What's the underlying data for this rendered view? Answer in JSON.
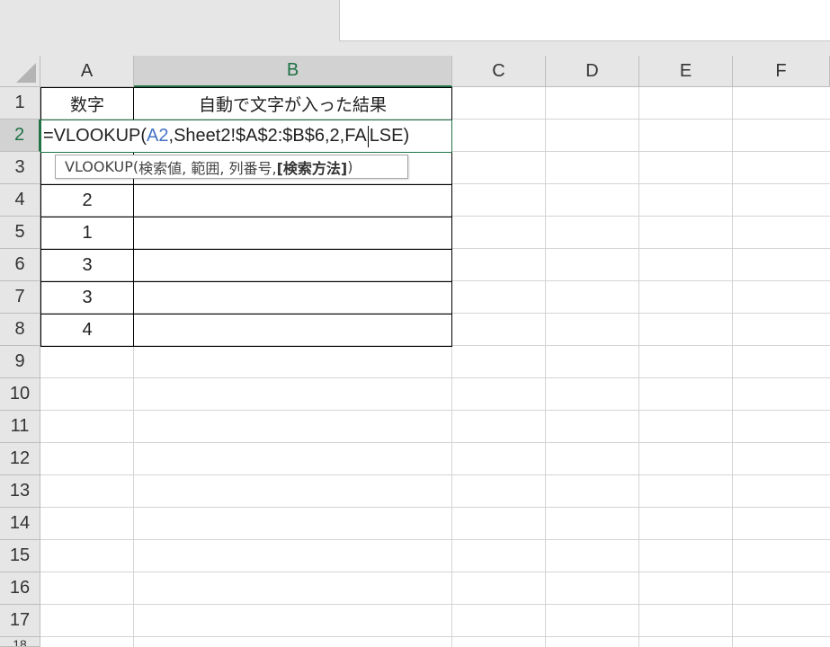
{
  "columns": [
    "A",
    "B",
    "C",
    "D",
    "E",
    "F"
  ],
  "rows": [
    "1",
    "2",
    "3",
    "4",
    "5",
    "6",
    "7",
    "8",
    "9",
    "10",
    "11",
    "12",
    "13",
    "14",
    "15",
    "16",
    "17",
    "18"
  ],
  "active_column": "B",
  "active_row": "2",
  "cells": {
    "a1": "数字",
    "b1": "自動で文字が入った結果",
    "a4": "2",
    "a5": "1",
    "a6": "3",
    "a7": "3",
    "a8": "4"
  },
  "formula": {
    "prefix": "=VLOOKUP(",
    "ref": "A2",
    "middle": ",Sheet2!$A$2:$B$6,2,FA",
    "after_caret": "LSE)"
  },
  "tooltip": {
    "func": "VLOOKUP(",
    "args": "検索値, 範囲, 列番号, ",
    "optional": "[検索方法]",
    "close": ")"
  },
  "colors": {
    "accent": "#217346",
    "ref_blue": "#4472c4"
  }
}
